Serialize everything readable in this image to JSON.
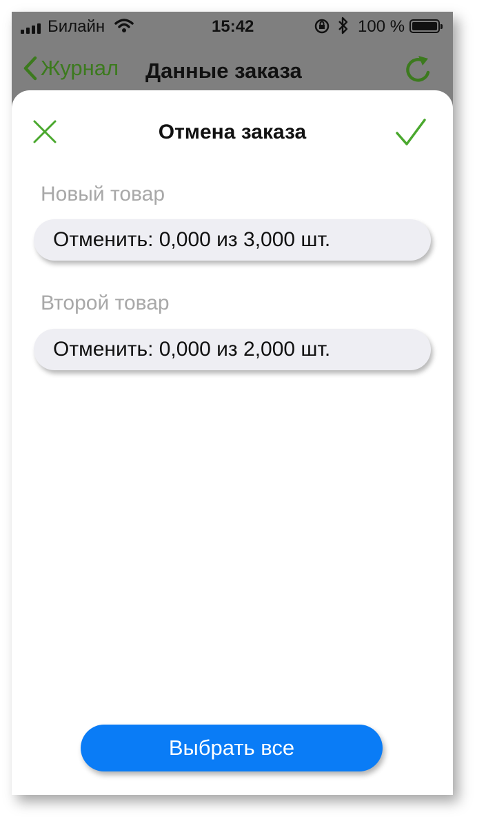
{
  "status_bar": {
    "carrier": "Билайн",
    "time": "15:42",
    "battery": "100 %"
  },
  "nav": {
    "back_label": "Журнал",
    "title": "Данные заказа"
  },
  "sheet": {
    "title": "Отмена заказа",
    "items": [
      {
        "label": "Новый товар",
        "value": "Отменить: 0,000 из 3,000 шт."
      },
      {
        "label": "Второй товар",
        "value": "Отменить: 0,000 из 2,000 шт."
      }
    ],
    "select_all": "Выбрать все"
  },
  "colors": {
    "accent_green": "#4aa82e",
    "nav_green": "#3c7a1e",
    "button_blue": "#0a7cf6",
    "label_gray": "#a8a8a8"
  }
}
